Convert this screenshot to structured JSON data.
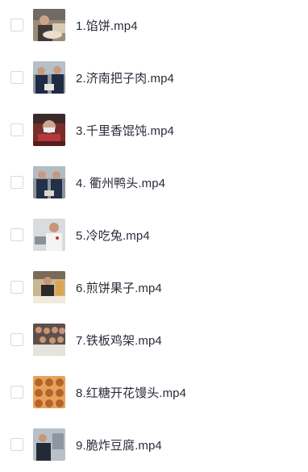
{
  "files": [
    {
      "name": "1.馅饼.mp4",
      "thumbnail": "video-thumbnail-pastry",
      "checked": false
    },
    {
      "name": "2.济南把子肉.mp4",
      "thumbnail": "video-thumbnail-chefs",
      "checked": false
    },
    {
      "name": "3.千里香馄饨.mp4",
      "thumbnail": "video-thumbnail-masked-cook",
      "checked": false
    },
    {
      "name": "4. 衢州鸭头.mp4",
      "thumbnail": "video-thumbnail-chefs",
      "checked": false
    },
    {
      "name": "5.冷吃兔.mp4",
      "thumbnail": "video-thumbnail-chef-white",
      "checked": false
    },
    {
      "name": "6.煎饼果子.mp4",
      "thumbnail": "video-thumbnail-kitchen",
      "checked": false
    },
    {
      "name": "7.铁板鸡架.mp4",
      "thumbnail": "video-thumbnail-class",
      "checked": false
    },
    {
      "name": "8.红糖开花馒头.mp4",
      "thumbnail": "video-thumbnail-buns",
      "checked": false
    },
    {
      "name": "9.脆炸豆腐.mp4",
      "thumbnail": "video-thumbnail-chef-dark",
      "checked": false
    }
  ]
}
